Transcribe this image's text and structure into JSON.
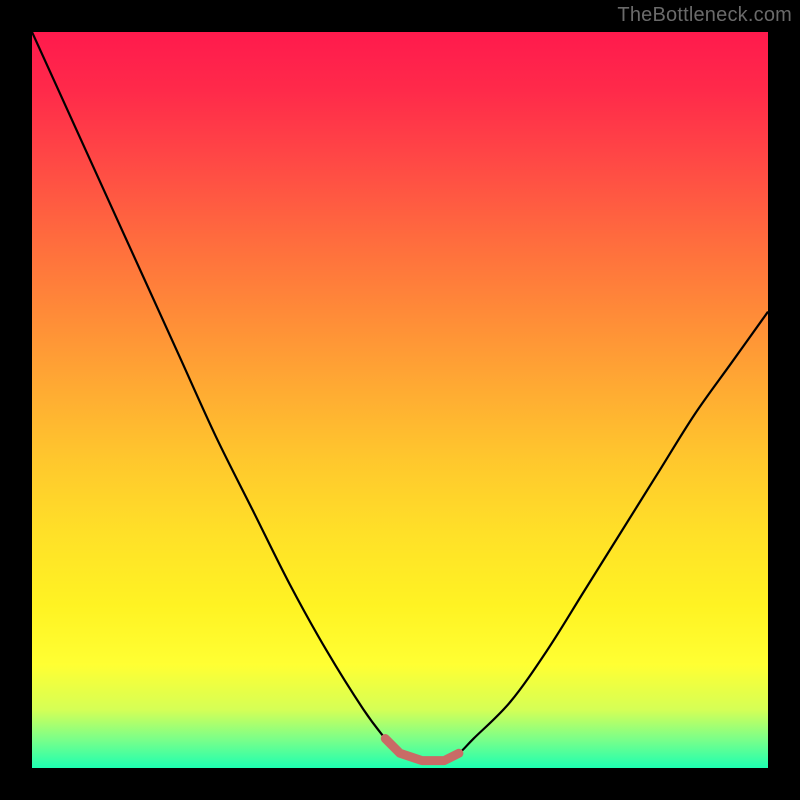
{
  "watermark": "TheBottleneck.com",
  "colors": {
    "background": "#000000",
    "gradient_top": "#ff1a4d",
    "gradient_bottom": "#1dffb1",
    "curve": "#000000",
    "marker": "#c96b66"
  },
  "chart_data": {
    "type": "line",
    "title": "",
    "xlabel": "",
    "ylabel": "",
    "xlim": [
      0,
      100
    ],
    "ylim": [
      0,
      100
    ],
    "grid": false,
    "legend": false,
    "series": [
      {
        "name": "bottleneck-curve",
        "x": [
          0,
          5,
          10,
          15,
          20,
          25,
          30,
          35,
          40,
          45,
          48,
          50,
          53,
          56,
          58,
          60,
          65,
          70,
          75,
          80,
          85,
          90,
          95,
          100
        ],
        "y": [
          100,
          89,
          78,
          67,
          56,
          45,
          35,
          25,
          16,
          8,
          4,
          2,
          1,
          1,
          2,
          4,
          9,
          16,
          24,
          32,
          40,
          48,
          55,
          62
        ]
      }
    ],
    "flat_region": {
      "x_start": 48,
      "x_end": 58,
      "y_approx": 1.5
    }
  }
}
